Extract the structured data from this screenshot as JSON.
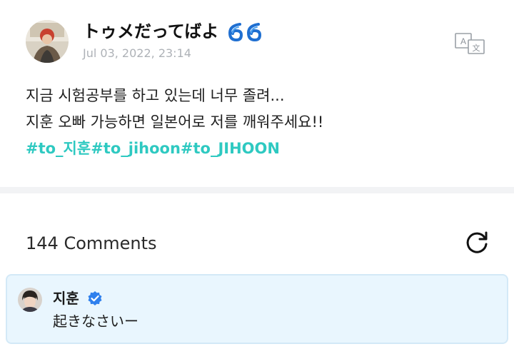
{
  "post": {
    "author": {
      "name": "トゥメだってばよ",
      "emoji": "cyclone-emoji",
      "avatar_icon": "user-avatar"
    },
    "date": "Jul 03, 2022, 23:14",
    "translate_icon": "translate-icon",
    "body_lines": [
      "지금 시험공부를 하고 있는데 너무 졸려...",
      "지훈 오빠 가능하면 일본어로 저를 깨워주세요!!"
    ],
    "hashtags": [
      "#to_지훈",
      "#to_jihoon",
      "#to_JIHOON"
    ]
  },
  "comments": {
    "count_label": "144 Comments",
    "refresh_icon": "refresh-icon",
    "highlighted": {
      "author": "지훈",
      "verified_icon": "verified-badge-icon",
      "text": "起きなさいー"
    }
  },
  "colors": {
    "hashtag": "#2ec9c1",
    "date": "#aeb2b7",
    "divider": "#f2f3f5",
    "comment_bg": "#e9f6fe",
    "comment_border": "#d3e9f7",
    "verified": "#2f80ed"
  }
}
